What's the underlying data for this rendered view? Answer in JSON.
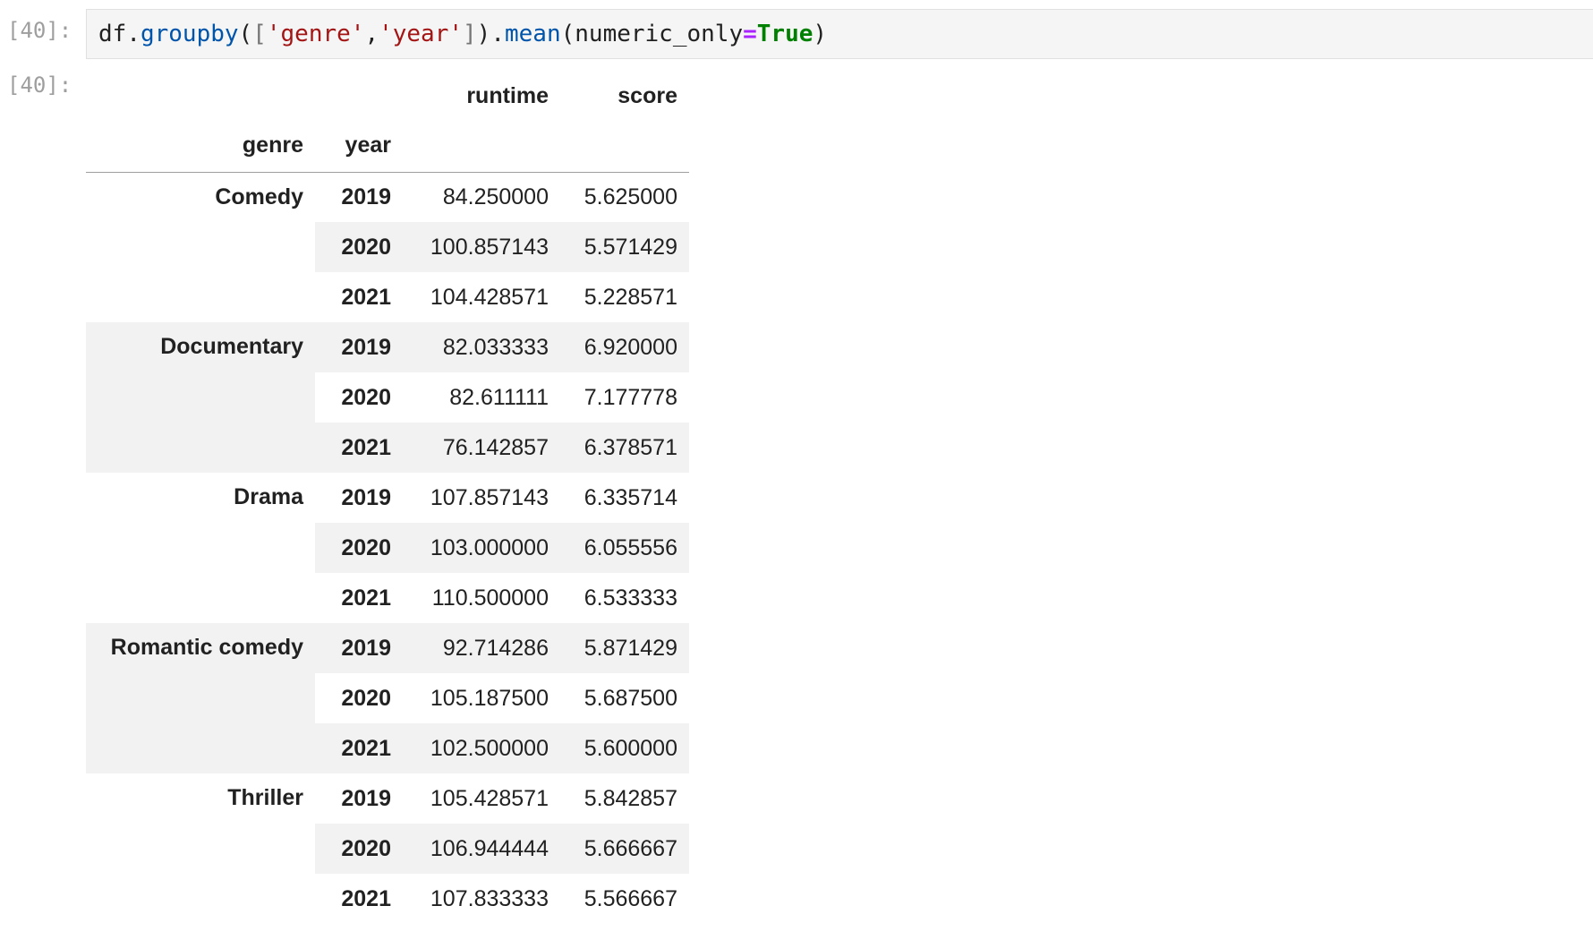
{
  "cell": {
    "input_prompt": "[40]:",
    "output_prompt": "[40]:",
    "code": {
      "obj": "df",
      "dot1": ".",
      "method1": "groupby",
      "open_paren": "(",
      "open_bracket": "[",
      "arg1": "'genre'",
      "comma": ",",
      "arg2": "'year'",
      "close_bracket": "]",
      "close_paren": ")",
      "dot2": ".",
      "method2": "mean",
      "open_paren2": "(",
      "kwarg": "numeric_only",
      "equals": "=",
      "kwval": "True",
      "close_paren2": ")"
    }
  },
  "table": {
    "columns": [
      "runtime",
      "score"
    ],
    "index_names": [
      "genre",
      "year"
    ],
    "groups": [
      {
        "genre": "Comedy",
        "rows": [
          {
            "year": "2019",
            "runtime": "84.250000",
            "score": "5.625000"
          },
          {
            "year": "2020",
            "runtime": "100.857143",
            "score": "5.571429"
          },
          {
            "year": "2021",
            "runtime": "104.428571",
            "score": "5.228571"
          }
        ]
      },
      {
        "genre": "Documentary",
        "rows": [
          {
            "year": "2019",
            "runtime": "82.033333",
            "score": "6.920000"
          },
          {
            "year": "2020",
            "runtime": "82.611111",
            "score": "7.177778"
          },
          {
            "year": "2021",
            "runtime": "76.142857",
            "score": "6.378571"
          }
        ]
      },
      {
        "genre": "Drama",
        "rows": [
          {
            "year": "2019",
            "runtime": "107.857143",
            "score": "6.335714"
          },
          {
            "year": "2020",
            "runtime": "103.000000",
            "score": "6.055556"
          },
          {
            "year": "2021",
            "runtime": "110.500000",
            "score": "6.533333"
          }
        ]
      },
      {
        "genre": "Romantic comedy",
        "rows": [
          {
            "year": "2019",
            "runtime": "92.714286",
            "score": "5.871429"
          },
          {
            "year": "2020",
            "runtime": "105.187500",
            "score": "5.687500"
          },
          {
            "year": "2021",
            "runtime": "102.500000",
            "score": "5.600000"
          }
        ]
      },
      {
        "genre": "Thriller",
        "rows": [
          {
            "year": "2019",
            "runtime": "105.428571",
            "score": "5.842857"
          },
          {
            "year": "2020",
            "runtime": "106.944444",
            "score": "5.666667"
          },
          {
            "year": "2021",
            "runtime": "107.833333",
            "score": "5.566667"
          }
        ]
      }
    ]
  }
}
